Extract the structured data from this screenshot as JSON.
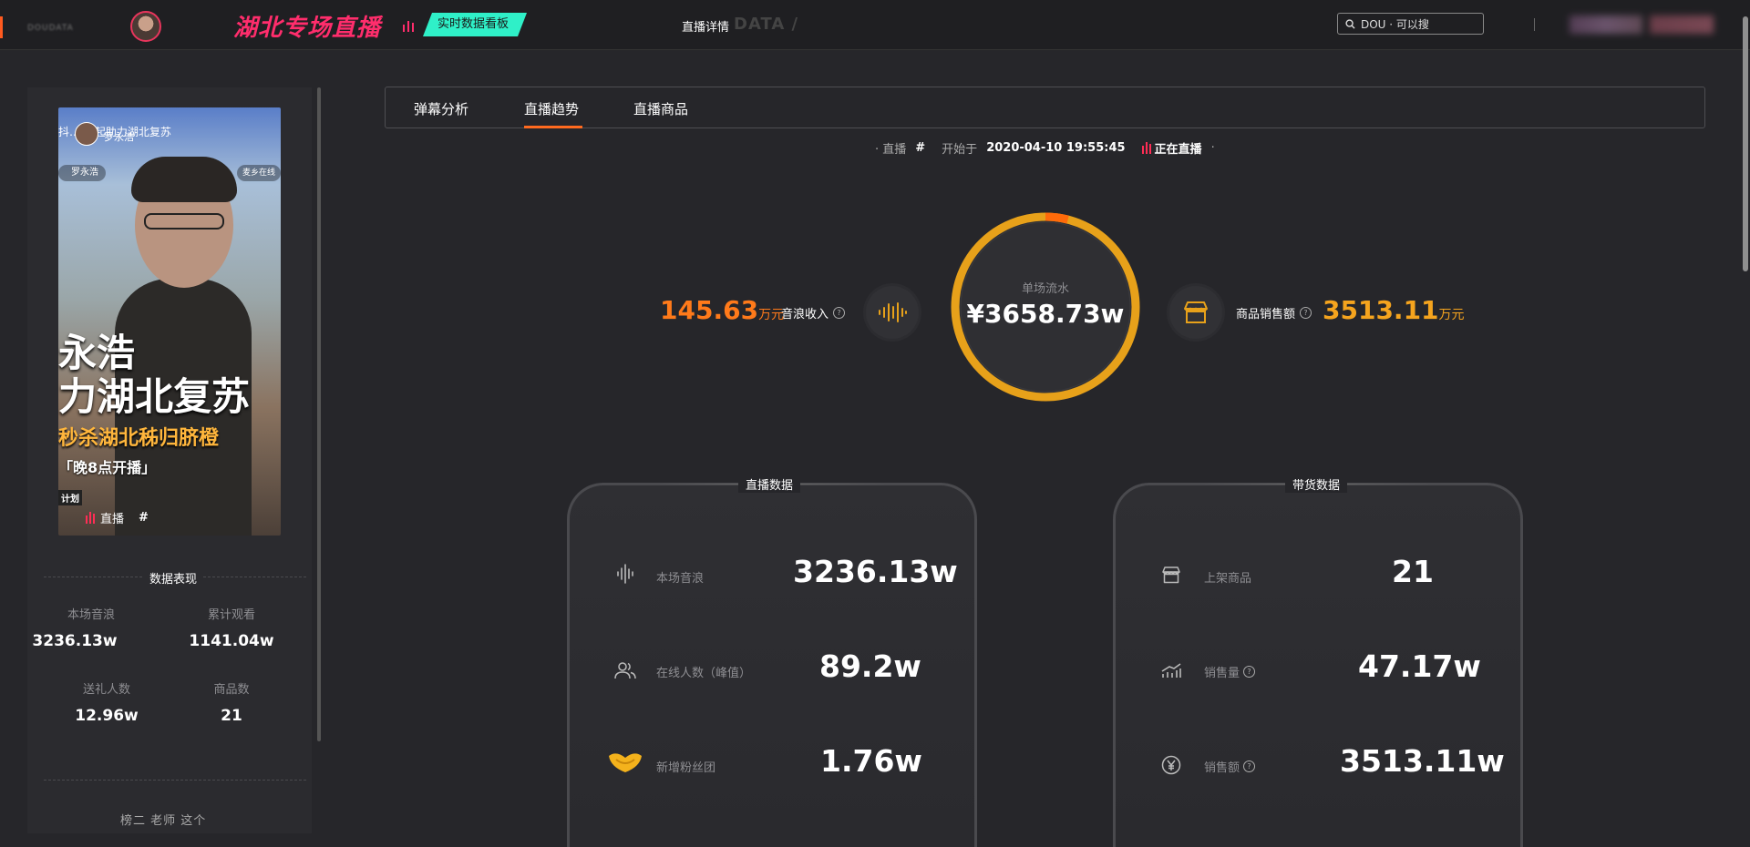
{
  "header": {
    "brand": "DOUDATA",
    "live_title": "湖北专场直播",
    "realtime_badge": "实时数据看板",
    "detail_label": "直播详情",
    "data_word": "DATA /",
    "search": {
      "placeholder": "DOU · 可以搜"
    }
  },
  "cover": {
    "top_text": "抖… 一起助力湖北复苏",
    "streamer": "罗永浩",
    "chip": "罗永浩",
    "chip_right": "麦乡在线",
    "big_line1": "永浩",
    "big_line2": "力湖北复苏",
    "orange_line": "秒杀湖北秭归脐橙",
    "time_line": "「晚8点开播」",
    "plan_tag": "计划",
    "live_label": "直播",
    "live_hash": "#"
  },
  "performance": {
    "title": "数据表现",
    "stats": [
      {
        "label": "本场音浪",
        "value": "3236.13w"
      },
      {
        "label": "累计观看",
        "value": "1141.04w"
      },
      {
        "label": "送礼人数",
        "value": "12.96w"
      },
      {
        "label": "商品数",
        "value": "21"
      }
    ],
    "bottom_text": "榜二  老师  这个"
  },
  "tabs": [
    {
      "label": "弹幕分析",
      "active": false
    },
    {
      "label": "直播趋势",
      "active": true
    },
    {
      "label": "直播商品",
      "active": false
    }
  ],
  "info": {
    "live_prefix": "· 直播",
    "hash": "#",
    "start_label": "开始于",
    "start_time": "2020-04-10 19:55:45",
    "status": "正在直播",
    "suffix": "·"
  },
  "ring": {
    "label": "单场流水",
    "value": "¥3658.73w",
    "share_highlight": 0.04,
    "color_main": "#e7a11a",
    "color_highlight": "#ff6a0a"
  },
  "left_metric": {
    "value": "145.63",
    "unit": "万元",
    "label": "音浪收入"
  },
  "right_metric": {
    "value": "3513.11",
    "unit": "万元",
    "label": "商品销售额"
  },
  "live_card": {
    "title": "直播数据",
    "rows": [
      {
        "icon": "waveform-icon",
        "label": "本场音浪",
        "value": "3236.13w"
      },
      {
        "icon": "users-icon",
        "label": "在线人数（峰值）",
        "value": "89.2w"
      },
      {
        "icon": "fan-club-icon",
        "label": "新增粉丝团",
        "value": "1.76w"
      }
    ]
  },
  "goods_card": {
    "title": "带货数据",
    "rows": [
      {
        "icon": "store-icon",
        "label": "上架商品",
        "value": "21",
        "help": false
      },
      {
        "icon": "sales-chart-icon",
        "label": "销售量",
        "value": "47.17w",
        "help": true
      },
      {
        "icon": "yen-icon",
        "label": "销售额",
        "value": "3513.11w",
        "help": true
      }
    ]
  },
  "colors": {
    "accent": "#ff6a1f",
    "brand_pink": "#ff2d6c",
    "teal": "#2ff0c8",
    "gold": "#e7a11a"
  }
}
